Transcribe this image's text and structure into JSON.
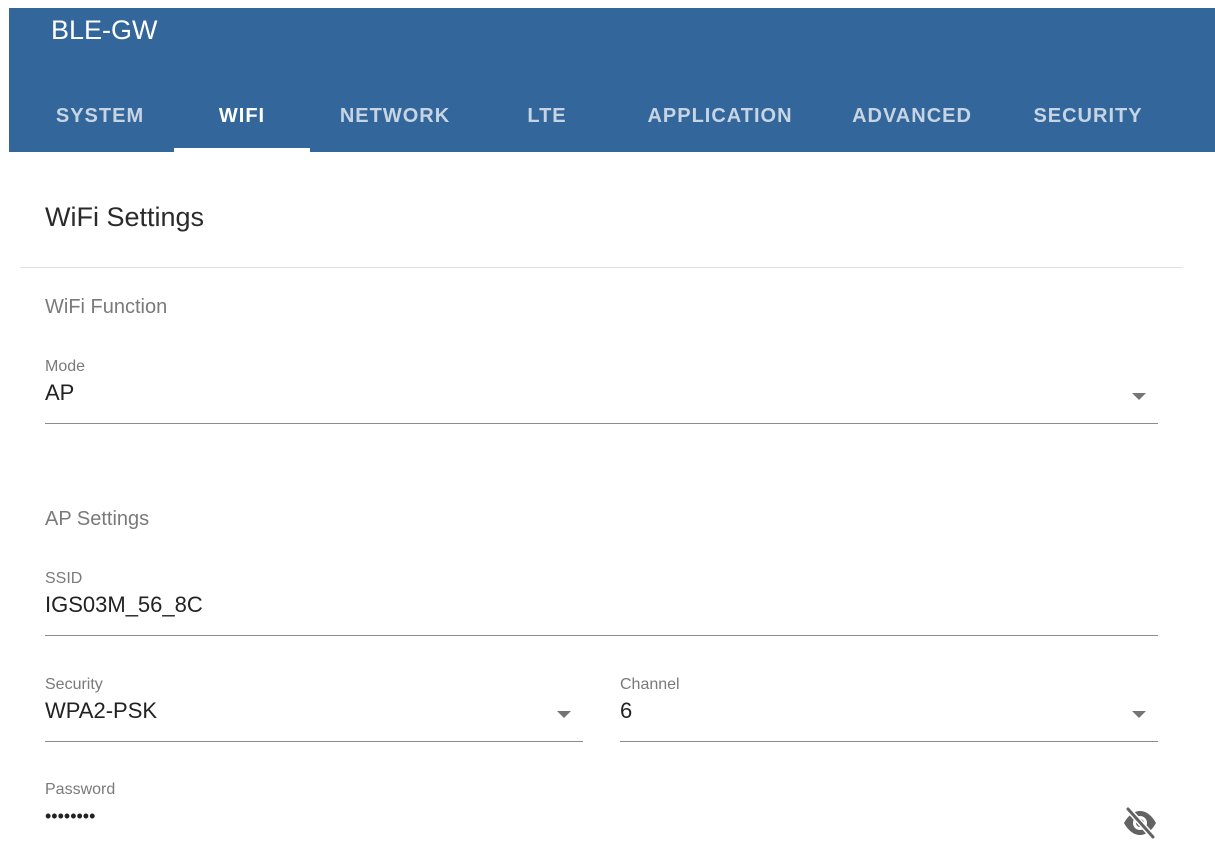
{
  "app": {
    "title": "BLE-GW"
  },
  "tabs": [
    {
      "label": "SYSTEM",
      "active": false
    },
    {
      "label": "WIFI",
      "active": true
    },
    {
      "label": "NETWORK",
      "active": false
    },
    {
      "label": "LTE",
      "active": false
    },
    {
      "label": "APPLICATION",
      "active": false
    },
    {
      "label": "ADVANCED",
      "active": false
    },
    {
      "label": "SECURITY",
      "active": false
    }
  ],
  "page": {
    "title": "WiFi Settings"
  },
  "wifi_function": {
    "section_label": "WiFi Function",
    "mode": {
      "label": "Mode",
      "value": "AP"
    }
  },
  "ap_settings": {
    "section_label": "AP Settings",
    "ssid": {
      "label": "SSID",
      "value": "IGS03M_56_8C"
    },
    "security": {
      "label": "Security",
      "value": "WPA2-PSK"
    },
    "channel": {
      "label": "Channel",
      "value": "6"
    },
    "password": {
      "label": "Password",
      "value": "••••••••"
    }
  },
  "icons": {
    "dropdown": "chevron-down-icon",
    "password_toggle": "eye-off-icon"
  },
  "colors": {
    "appbar": "#33669a",
    "tab_inactive": "rgba(255,255,255,0.72)",
    "tab_active": "#ffffff"
  }
}
